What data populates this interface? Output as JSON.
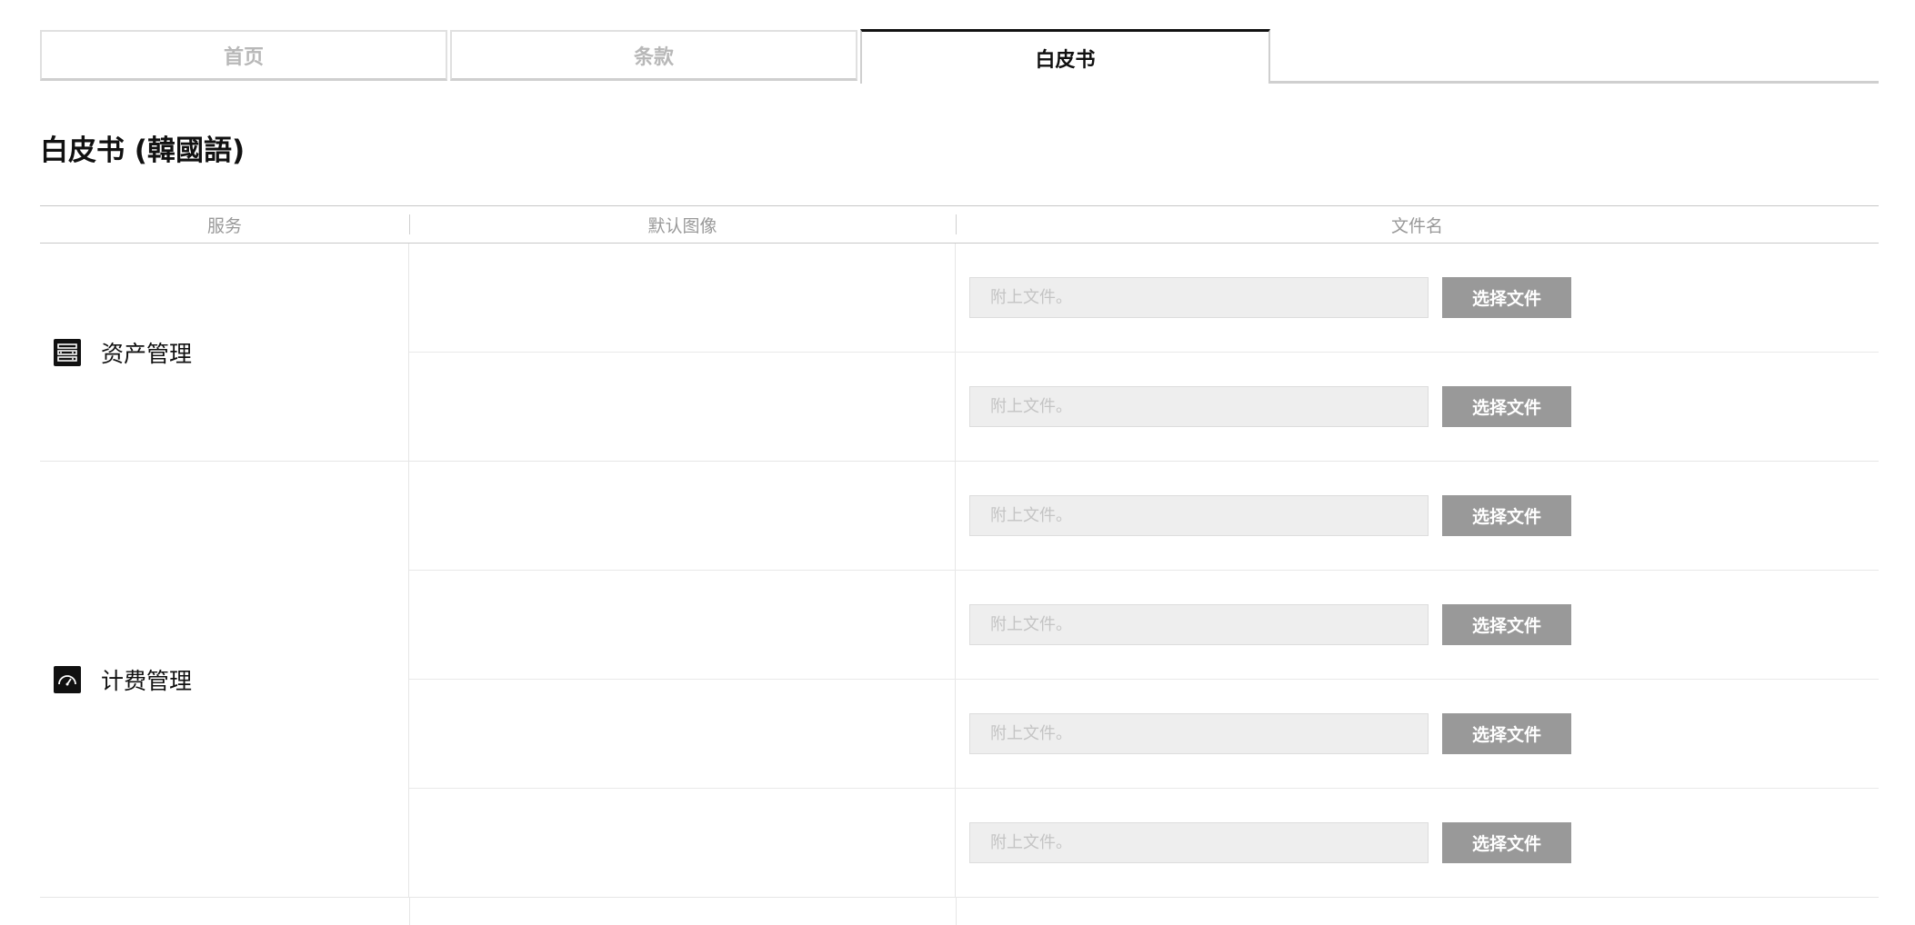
{
  "tabs": [
    {
      "label": "首页",
      "active": false
    },
    {
      "label": "条款",
      "active": false
    },
    {
      "label": "白皮书",
      "active": true
    }
  ],
  "page_title": "白皮书 (韓國語)",
  "table": {
    "headers": {
      "service": "服务",
      "default_image": "默认图像",
      "file_name": "文件名"
    },
    "groups": [
      {
        "service": "资产管理",
        "icon": "server-list-icon",
        "rows": [
          {
            "placeholder": "附上文件。",
            "button": "选择文件"
          },
          {
            "placeholder": "附上文件。",
            "button": "选择文件"
          }
        ]
      },
      {
        "service": "计费管理",
        "icon": "gauge-icon",
        "rows": [
          {
            "placeholder": "附上文件。",
            "button": "选择文件"
          },
          {
            "placeholder": "附上文件。",
            "button": "选择文件"
          },
          {
            "placeholder": "附上文件。",
            "button": "选择文件"
          },
          {
            "placeholder": "附上文件。",
            "button": "选择文件"
          }
        ]
      }
    ]
  },
  "colors": {
    "active_tab_border": "#111111",
    "button_bg": "#999999",
    "input_bg": "#eeeeee",
    "header_text": "#999999"
  }
}
